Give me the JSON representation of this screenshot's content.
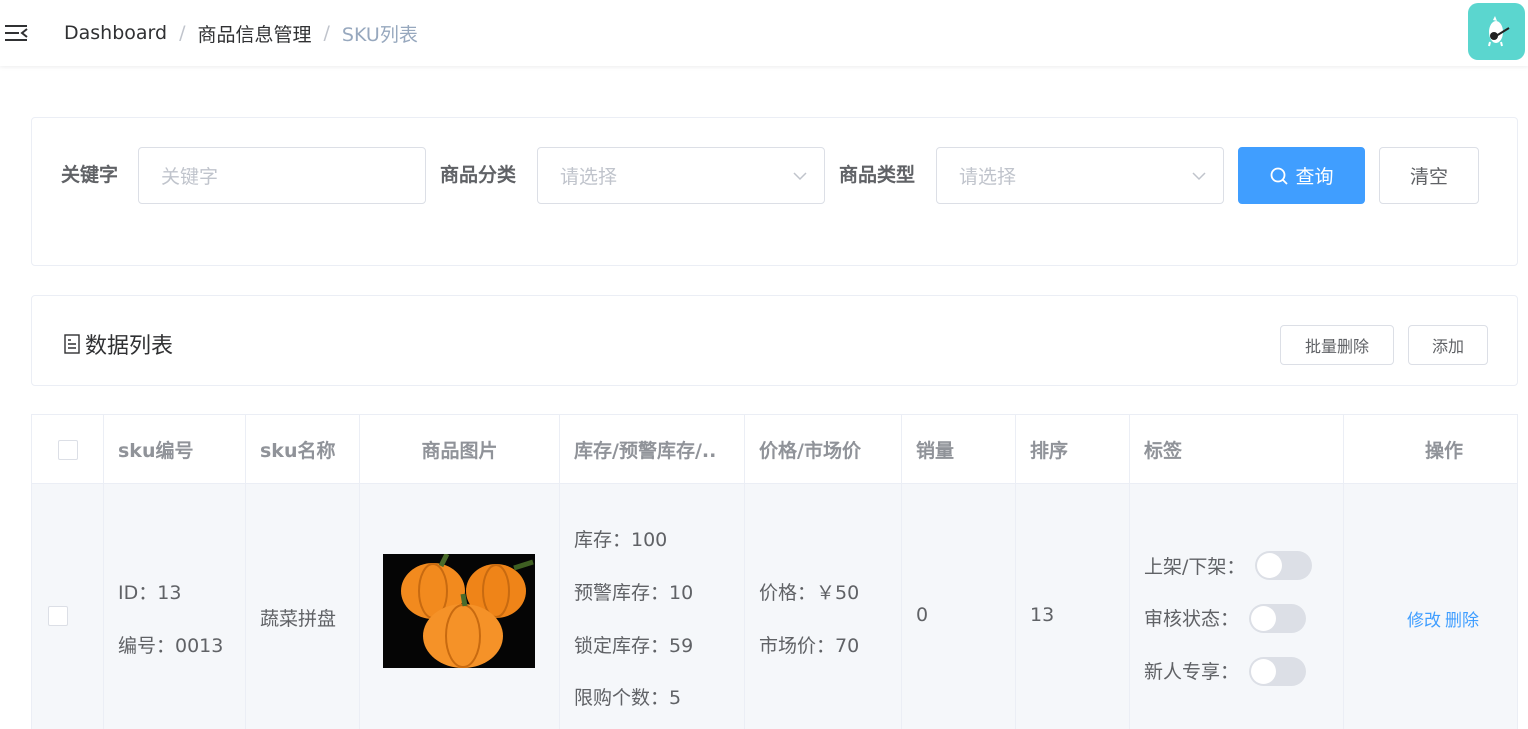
{
  "header": {
    "breadcrumb": [
      "Dashboard",
      "商品信息管理",
      "SKU列表"
    ],
    "separator": "/"
  },
  "search": {
    "keyword_label": "关键字",
    "keyword_placeholder": "关键字",
    "category_label": "商品分类",
    "category_placeholder": "请选择",
    "type_label": "商品类型",
    "type_placeholder": "请选择",
    "query_button": "查询",
    "clear_button": "清空"
  },
  "list": {
    "title": "数据列表",
    "batch_delete_button": "批量删除",
    "add_button": "添加"
  },
  "table": {
    "columns": [
      "sku编号",
      "sku名称",
      "商品图片",
      "库存/预警库存/..",
      "价格/市场价",
      "销量",
      "排序",
      "标签",
      "操作"
    ],
    "rows": [
      {
        "id_line": "ID：13",
        "code_line": "编号：0013",
        "name": "蔬菜拼盘",
        "stock": "库存：100",
        "warn_stock": "预警库存：10",
        "lock_stock": "锁定库存：59",
        "limit": "限购个数：5",
        "price": "价格：￥50",
        "market_price": "市场价：70",
        "sales": "0",
        "sort": "13",
        "tag_onsale": "上架/下架：",
        "tag_audit": "审核状态：",
        "tag_newuser": "新人专享：",
        "onsale_on": false,
        "audit_on": false,
        "newuser_on": false,
        "edit_link": "修改",
        "delete_link": "删除"
      }
    ]
  },
  "colors": {
    "primary": "#409eff",
    "avatar_bg": "#5bd6cf",
    "row_bg": "#f5f7fa",
    "pumpkin": "#f28a1e"
  }
}
